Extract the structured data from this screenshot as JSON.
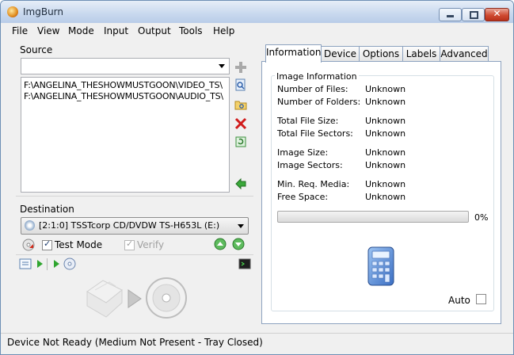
{
  "window": {
    "title": "ImgBurn"
  },
  "menu": [
    "File",
    "View",
    "Mode",
    "Input",
    "Output",
    "Tools",
    "Help"
  ],
  "source": {
    "label": "Source",
    "combo_value": "",
    "files": [
      "F:\\ANGELINA_THESHOWMUSTGOON\\VIDEO_TS\\",
      "F:\\ANGELINA_THESHOWMUSTGOON\\AUDIO_TS\\"
    ]
  },
  "destination": {
    "label": "Destination",
    "drive": "[2:1:0] TSSTcorp CD/DVDW TS-H653L (E:)",
    "test_mode_label": "Test Mode",
    "test_mode_checked": true,
    "verify_label": "Verify",
    "verify_checked": true,
    "verify_enabled": false
  },
  "tabs": [
    "Information",
    "Device",
    "Options",
    "Labels",
    "Advanced"
  ],
  "active_tab": "Information",
  "info": {
    "group_label": "Image Information",
    "rows": [
      {
        "label": "Number of Files:",
        "value": "Unknown"
      },
      {
        "label": "Number of Folders:",
        "value": "Unknown"
      },
      {
        "label": "Total File Size:",
        "value": "Unknown"
      },
      {
        "label": "Total File Sectors:",
        "value": "Unknown"
      },
      {
        "label": "Image Size:",
        "value": "Unknown"
      },
      {
        "label": "Image Sectors:",
        "value": "Unknown"
      },
      {
        "label": "Min. Req. Media:",
        "value": "Unknown"
      },
      {
        "label": "Free Space:",
        "value": "Unknown"
      }
    ],
    "progress_text": "0%",
    "progress": 0,
    "auto_label": "Auto",
    "auto_checked": false
  },
  "status": {
    "text": "Device Not Ready (Medium Not Present - Tray Closed)"
  },
  "icons": {
    "app": "imgburn-logo-icon",
    "add": "plus-icon",
    "browse_files": "browse-file-icon",
    "browse_folder": "folder-icon",
    "remove": "red-x-icon",
    "calculate": "refresh-icon",
    "build": "green-arrow-icon",
    "calculator": "calculator-icon"
  },
  "colors": {
    "accent": "#3a7bd5",
    "remove": "#d11b1b",
    "green": "#2fa52f"
  }
}
